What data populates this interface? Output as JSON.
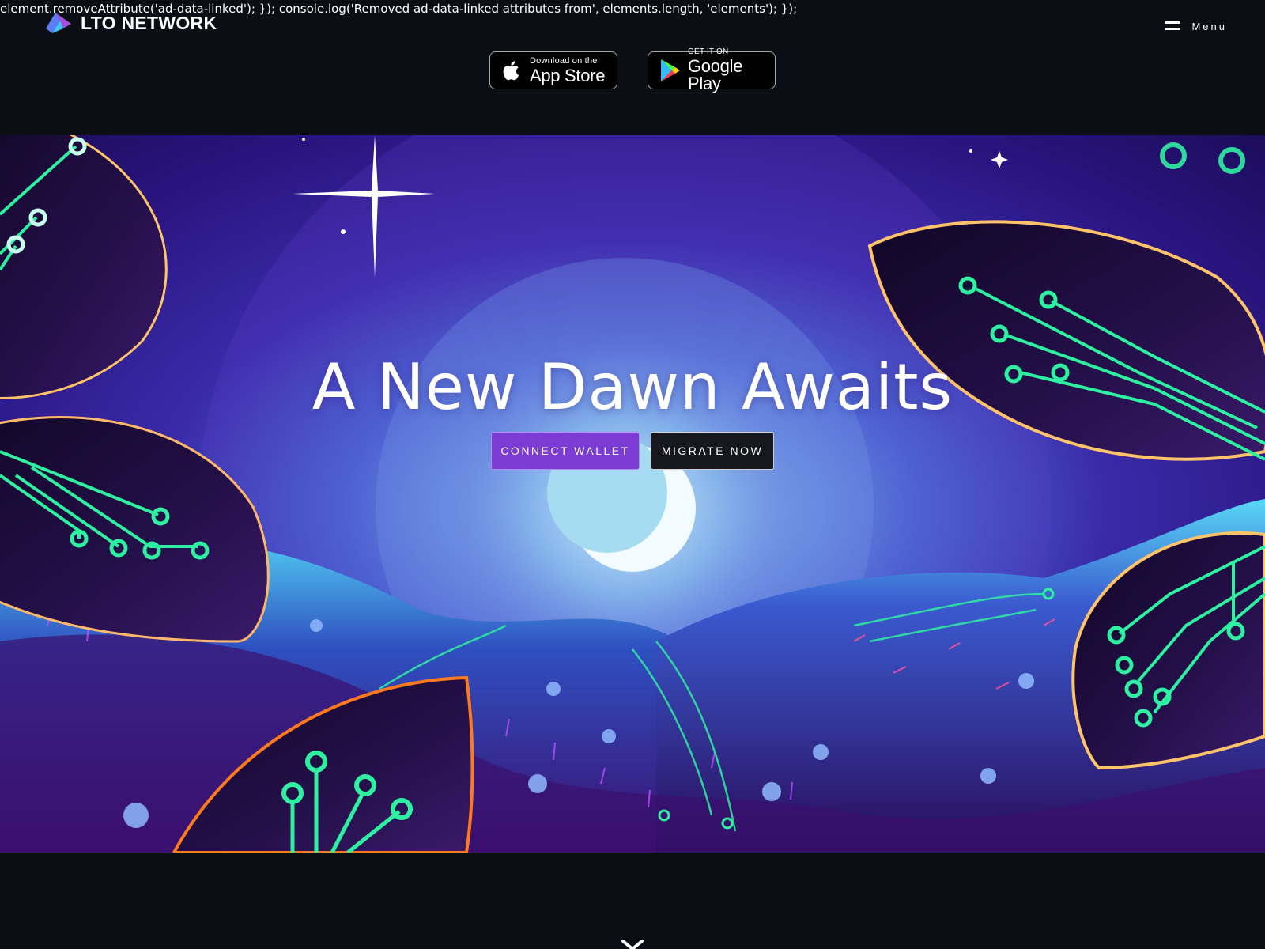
{
  "debug_overlay": {
    "text": "element.removeAttribute('ad-data-linked'); }); console.log('Removed ad-data-linked attributes from', elements.length, 'elements'); });"
  },
  "header": {
    "logo_text": "LTO NETWORK",
    "menu_label": "Menu"
  },
  "app_badges": {
    "apple": {
      "small": "Download on the",
      "large": "App Store"
    },
    "google": {
      "small": "GET IT ON",
      "large": "Google Play"
    }
  },
  "hero": {
    "title": "A New Dawn Awaits",
    "connect_label": "CONNECT WALLET",
    "migrate_label": "MIGRATE NOW"
  },
  "icons": [
    "lto-logo-icon",
    "hamburger-icon",
    "apple-icon",
    "google-play-icon",
    "chevron-down-icon"
  ],
  "colors": {
    "page_background": "#0b0e14",
    "connect_button": "#7c3bd3",
    "migrate_button": "#16181d",
    "circuit_green": "#2ef0a0",
    "sky_purple": "#3a1fa0",
    "moon_glow": "#bfe9f5"
  }
}
